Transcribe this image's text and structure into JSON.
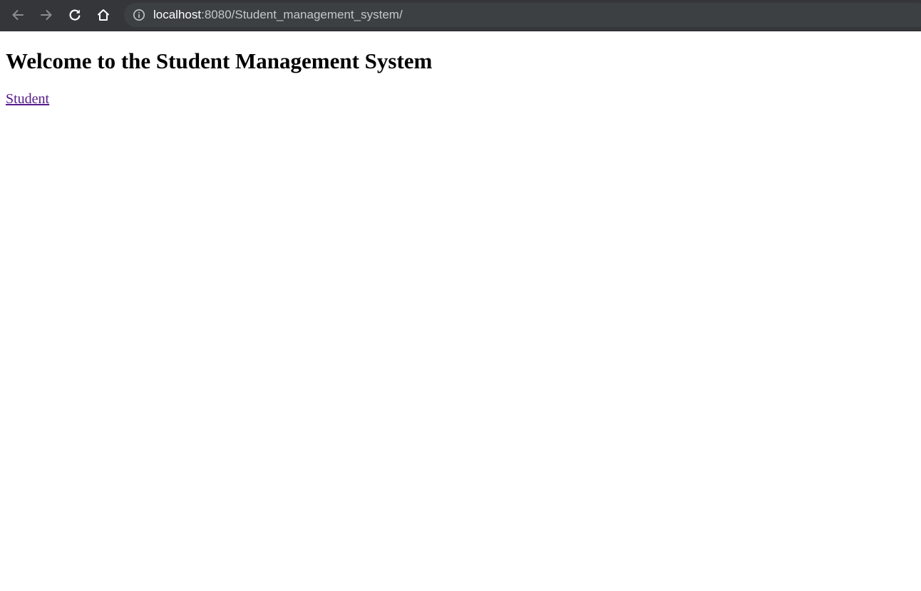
{
  "browser": {
    "url_host": "localhost",
    "url_rest": ":8080/Student_management_system/",
    "icons": [
      "back-icon",
      "forward-icon",
      "reload-icon",
      "home-icon",
      "site-info-icon"
    ],
    "colors": {
      "toolbar": "#35363a",
      "omnibox": "#3c4043",
      "visited_link": "#551a8b"
    }
  },
  "page": {
    "heading": "Welcome to the Student Management System",
    "links": [
      {
        "label": "Student"
      }
    ]
  }
}
